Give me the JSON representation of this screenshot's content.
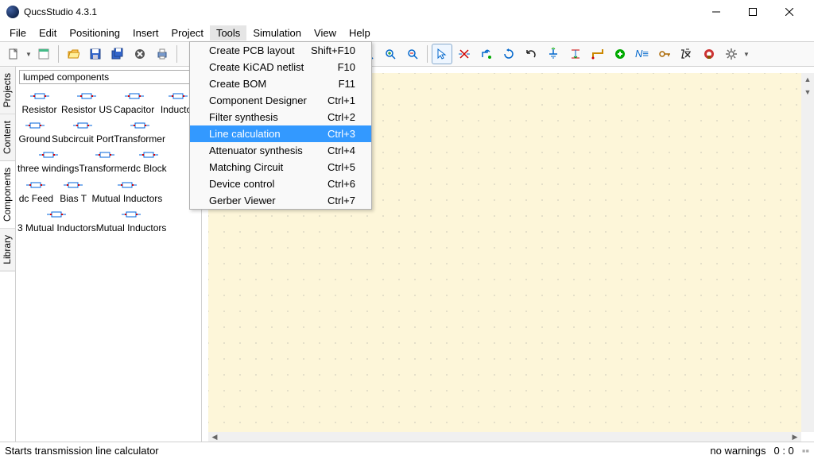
{
  "app": {
    "title": "QucsStudio 4.3.1"
  },
  "menu": {
    "items": [
      "File",
      "Edit",
      "Positioning",
      "Insert",
      "Project",
      "Tools",
      "Simulation",
      "View",
      "Help"
    ],
    "open_index": 5
  },
  "tools_menu": {
    "items": [
      {
        "label": "Create PCB layout",
        "shortcut": "Shift+F10"
      },
      {
        "label": "Create KiCAD netlist",
        "shortcut": "F10"
      },
      {
        "label": "Create BOM",
        "shortcut": "F11"
      },
      {
        "label": "Component Designer",
        "shortcut": "Ctrl+1"
      },
      {
        "label": "Filter synthesis",
        "shortcut": "Ctrl+2"
      },
      {
        "label": "Line calculation",
        "shortcut": "Ctrl+3"
      },
      {
        "label": "Attenuator synthesis",
        "shortcut": "Ctrl+4"
      },
      {
        "label": "Matching Circuit",
        "shortcut": "Ctrl+5"
      },
      {
        "label": "Device control",
        "shortcut": "Ctrl+6"
      },
      {
        "label": "Gerber Viewer",
        "shortcut": "Ctrl+7"
      }
    ],
    "highlighted_index": 5
  },
  "side": {
    "header": "lumped components",
    "tabs": [
      "Projects",
      "Content",
      "Components",
      "Library"
    ],
    "active_tab": 2,
    "rows": [
      [
        "Resistor",
        "Resistor US",
        "Capacitor",
        "Inductor"
      ],
      [
        "Ground",
        "Subcircuit Port",
        "Transformer",
        ""
      ],
      [
        "three windings",
        "Transformer",
        "dc Block",
        ""
      ],
      [
        "dc Feed",
        "Bias T",
        "Mutual Inductors",
        ""
      ],
      [
        "3 Mutual Inductors",
        "Mutual Inductors",
        "",
        ""
      ]
    ]
  },
  "status": {
    "left": "Starts transmission line calculator",
    "right_warn": "no warnings",
    "right_pos": "0 : 0"
  },
  "toolbar_icons": [
    "new",
    "new-dd",
    "template",
    "",
    "open",
    "save",
    "save-all",
    "close",
    "print",
    "",
    "zoom-fit",
    "zoom-in",
    "zoom-out",
    "",
    "cursor",
    "cut-wire",
    "step",
    "loop",
    "undo",
    "insert-ground",
    "insert-port",
    "wire",
    "add-eqn",
    "name-net",
    "key",
    "formula",
    "del",
    "gear"
  ]
}
